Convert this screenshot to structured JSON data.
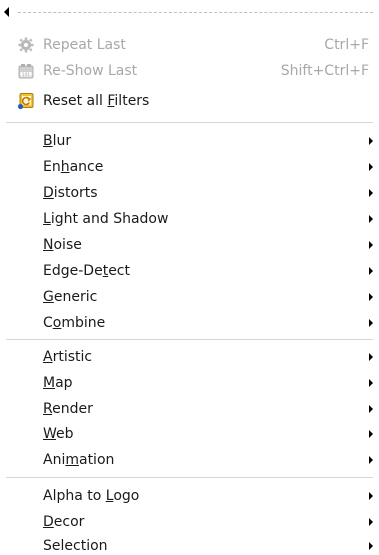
{
  "top_items": [
    {
      "pre": "Repeat Last",
      "ul": "",
      "post": "",
      "accel": "Ctrl+F",
      "icon": "gear-icon",
      "disabled": true
    },
    {
      "pre": "Re-Show Last",
      "ul": "",
      "post": "",
      "accel": "Shift+Ctrl+F",
      "icon": "reshow-icon",
      "disabled": true
    },
    {
      "pre": "Reset all ",
      "ul": "F",
      "post": "ilters",
      "accel": "",
      "icon": "reset-icon",
      "disabled": false
    }
  ],
  "group1": [
    {
      "pre": "",
      "ul": "B",
      "post": "lur"
    },
    {
      "pre": "En",
      "ul": "h",
      "post": "ance"
    },
    {
      "pre": "",
      "ul": "D",
      "post": "istorts"
    },
    {
      "pre": "",
      "ul": "L",
      "post": "ight and Shadow"
    },
    {
      "pre": "",
      "ul": "N",
      "post": "oise"
    },
    {
      "pre": "Edge-De",
      "ul": "t",
      "post": "ect"
    },
    {
      "pre": "",
      "ul": "G",
      "post": "eneric"
    },
    {
      "pre": "C",
      "ul": "o",
      "post": "mbine"
    }
  ],
  "group2": [
    {
      "pre": "",
      "ul": "A",
      "post": "rtistic"
    },
    {
      "pre": "",
      "ul": "M",
      "post": "ap"
    },
    {
      "pre": "",
      "ul": "R",
      "post": "ender"
    },
    {
      "pre": "",
      "ul": "W",
      "post": "eb"
    },
    {
      "pre": "Ani",
      "ul": "m",
      "post": "ation"
    }
  ],
  "group3": [
    {
      "pre": "Alpha to ",
      "ul": "L",
      "post": "ogo"
    },
    {
      "pre": "",
      "ul": "D",
      "post": "ecor"
    },
    {
      "pre": "Selection",
      "ul": "",
      "post": ""
    }
  ]
}
